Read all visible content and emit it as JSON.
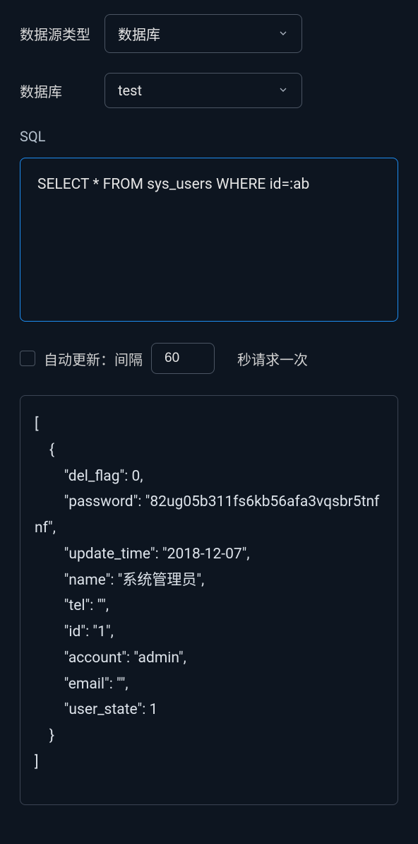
{
  "form": {
    "datasource_type_label": "数据源类型",
    "datasource_type_value": "数据库",
    "database_label": "数据库",
    "database_value": "test"
  },
  "sql": {
    "label": "SQL",
    "value": "SELECT * FROM sys_users WHERE id=:ab"
  },
  "auto_refresh": {
    "label_prefix": "自动更新：间隔",
    "interval_value": "60",
    "label_suffix": "秒请求一次"
  },
  "result_text": "[\n    {\n        \"del_flag\": 0,\n        \"password\": \"82ug05b311fs6kb56afa3vqsbr5tnfnf\",\n        \"update_time\": \"2018-12-07\",\n        \"name\": \"系统管理员\",\n        \"tel\": \"\",\n        \"id\": \"1\",\n        \"account\": \"admin\",\n        \"email\": \"\",\n        \"user_state\": 1\n    }\n]"
}
